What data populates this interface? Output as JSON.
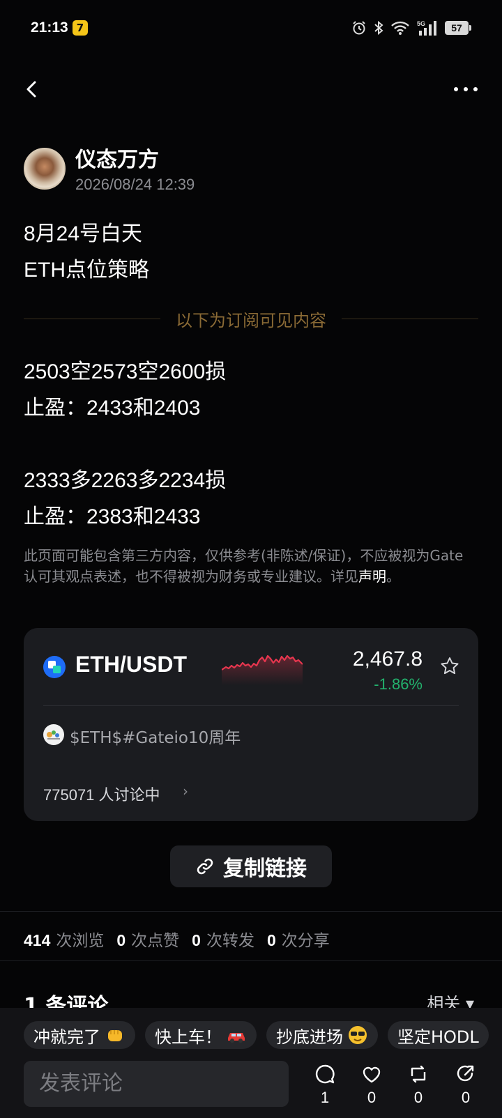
{
  "status_bar": {
    "time": "21:13",
    "battery": "57",
    "network": "5G"
  },
  "post": {
    "author": "仪态万方",
    "datetime": "2026/08/24 12:39",
    "title_lines": [
      "8月24号白天",
      "ETH点位策略"
    ],
    "subscriber_divider": "以下为订阅可见内容",
    "content_lines": [
      "2503空2573空2600损",
      "止盈：2433和2403",
      "2333多2263多2234损",
      "止盈：2383和2433"
    ],
    "disclaimer": "此页面可能包含第三方内容，仅供参考(非陈述/保证)，不应被视为Gate认可其观点表述，也不得被视为财务或专业建议。详见",
    "disclaimer_link": "声明",
    "disclaimer_end": "。"
  },
  "card": {
    "pair": "ETH/USDT",
    "price": "2,467.8",
    "change": "-1.86%",
    "change_color": "#23b26d",
    "sparkline_color": "#e8364f",
    "tag": "$ETH$#Gateio10周年",
    "discussion": "775071 人讨论中",
    "discussion_chevron": "›"
  },
  "copy_link_label": "复制链接",
  "stats": [
    {
      "value": "414",
      "label": "次浏览"
    },
    {
      "value": "0",
      "label": "次点赞"
    },
    {
      "value": "0",
      "label": "次转发"
    },
    {
      "value": "0",
      "label": "次分享"
    }
  ],
  "comments": {
    "header": "1 条评论",
    "sort_label": "相关 ▾"
  },
  "quick_replies": [
    {
      "text": "冲就完了",
      "emoji": "fist-emoji"
    },
    {
      "text": "快上车！",
      "emoji": "car-emoji"
    },
    {
      "text": "抄底进场",
      "emoji": "sunglasses-emoji"
    },
    {
      "text": "坚定HODL",
      "emoji": ""
    }
  ],
  "comment_placeholder": "发表评论",
  "actions": [
    {
      "name": "comment",
      "count": "1"
    },
    {
      "name": "like",
      "count": "0"
    },
    {
      "name": "repost",
      "count": "0"
    },
    {
      "name": "share",
      "count": "0"
    }
  ]
}
